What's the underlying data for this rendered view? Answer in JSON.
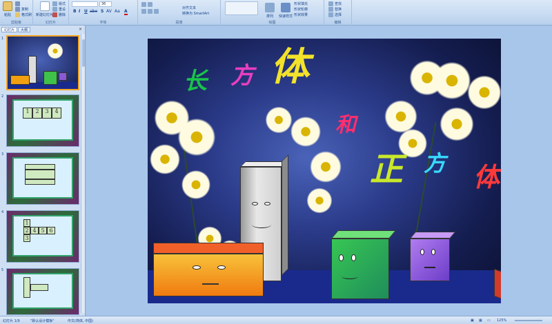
{
  "ribbon": {
    "clipboard": {
      "label": "剪贴板",
      "paste": "粘贴",
      "cut": "剪切",
      "copy": "复制",
      "format_painter": "格式刷"
    },
    "slides": {
      "label": "幻灯片",
      "new_slide": "新建幻灯片",
      "layout": "版式",
      "reset": "重设",
      "delete": "删除"
    },
    "font": {
      "label": "字体",
      "font_name": "",
      "font_size": "36",
      "bold": "B",
      "italic": "I",
      "underline": "U",
      "strike": "abe",
      "shadow": "S",
      "spacing": "AV",
      "case": "Aa",
      "color": "A"
    },
    "paragraph": {
      "label": "段落",
      "align_text": "对齐文本",
      "convert_smartart": "转换为 SmartArt"
    },
    "drawing": {
      "label": "绘图",
      "arrange": "排列",
      "quick_styles": "快速样式",
      "shape_fill": "形状填充",
      "shape_outline": "形状轮廓",
      "shape_effects": "形状效果"
    },
    "editing": {
      "label": "编辑",
      "find": "查找",
      "replace": "替换",
      "select": "选择"
    }
  },
  "leftpane": {
    "tabs": [
      "幻灯片",
      "大纲"
    ],
    "close": "×",
    "slides": [
      {
        "num": "1"
      },
      {
        "num": "2",
        "cells": [
          "1",
          "2",
          "3",
          "4"
        ]
      },
      {
        "num": "3"
      },
      {
        "num": "4",
        "cells": [
          "1",
          "2",
          "3",
          "4",
          "5",
          "6"
        ]
      },
      {
        "num": "5"
      }
    ]
  },
  "slide": {
    "title_chars": [
      "长",
      "方",
      "体",
      "和",
      "正",
      "方",
      "体"
    ]
  },
  "status": {
    "slide_info": "幻灯片 1/9",
    "theme": "\"默认设计模板\"",
    "language": "中文(简体, 中国)",
    "zoom": "125%"
  },
  "colors": {
    "char_1": "#19c44a",
    "char_2": "#e83fbf",
    "char_3": "#f2e22a",
    "char_4": "#ff2e6e",
    "char_5": "#c9e82a",
    "char_6": "#39d9ff",
    "char_7": "#ff3a3a"
  }
}
